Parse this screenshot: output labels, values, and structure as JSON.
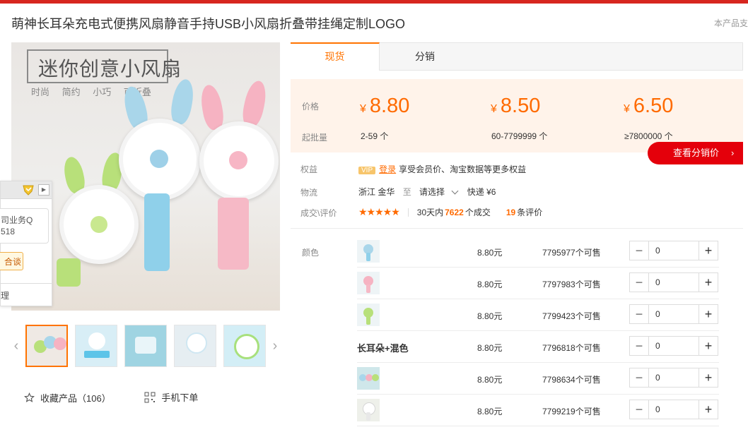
{
  "page": {
    "title": "萌神长耳朵充电式便携风扇静音手持USB小风扇折叠带挂绳定制LOGO",
    "support_note": "本产品支"
  },
  "gallery": {
    "promo_title": "迷你创意小风扇",
    "promo_tags": [
      "时尚",
      "简约",
      "小巧",
      "可折叠"
    ],
    "zoom_icon": "search-icon",
    "thumbnail_count": 5,
    "active_thumbnail": 0
  },
  "actions": {
    "favorite": "收藏产品（106）",
    "mobile_order": "手机下单"
  },
  "chat_widget": {
    "line1": "司业务Q",
    "line2": "518",
    "button": "合谈",
    "footer": "理"
  },
  "tabs": [
    {
      "label": "现货",
      "active": true
    },
    {
      "label": "分销",
      "active": false
    }
  ],
  "pricing": {
    "price_label": "价格",
    "moq_label": "起批量",
    "currency": "¥",
    "tiers": [
      {
        "price": "8.80",
        "range": "2-59 个"
      },
      {
        "price": "8.50",
        "range": "60-7799999 个"
      },
      {
        "price": "6.50",
        "range": "≥7800000 个"
      }
    ],
    "distribution_button": "查看分销价"
  },
  "rights": {
    "label": "权益",
    "vip_badge": "VIP",
    "login": "登录",
    "text": "享受会员价、淘宝数据等更多权益"
  },
  "logistics": {
    "label": "物流",
    "origin": "浙江 金华",
    "to": "至",
    "destination": "请选择",
    "shipping": "快递 ¥6"
  },
  "trade": {
    "label": "成交\\评价",
    "rating_stars": 5,
    "stars_text": "★★★★★",
    "period": "30天内",
    "deal_count": "7622",
    "deal_suffix": "个成交",
    "review_count": "19",
    "review_suffix": "条评价"
  },
  "sku": {
    "label": "颜色",
    "rows": [
      {
        "name": "",
        "thumb": "blue",
        "price": "8.80元",
        "stock": "7795977个可售",
        "qty": "0"
      },
      {
        "name": "",
        "thumb": "pink",
        "price": "8.80元",
        "stock": "7797983个可售",
        "qty": "0"
      },
      {
        "name": "",
        "thumb": "green",
        "price": "8.80元",
        "stock": "7799423个可售",
        "qty": "0"
      },
      {
        "name": "长耳朵+混色",
        "thumb": "",
        "price": "8.80元",
        "stock": "7796818个可售",
        "qty": "0"
      },
      {
        "name": "",
        "thumb": "mixed",
        "price": "8.80元",
        "stock": "7798634个可售",
        "qty": "0"
      },
      {
        "name": "",
        "thumb": "white",
        "price": "8.80元",
        "stock": "7799219个可售",
        "qty": "0"
      }
    ],
    "minus": "−",
    "plus": "+"
  },
  "colors": {
    "accent": "#ff6a00",
    "brand_red": "#e4000b",
    "price_bg": "#fff3ea"
  }
}
